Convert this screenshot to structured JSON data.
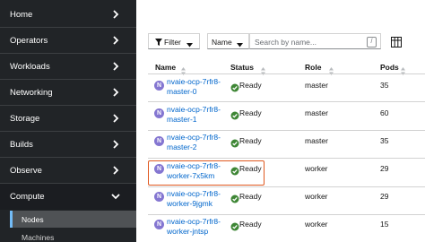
{
  "sidebar": {
    "items": [
      {
        "label": "Home"
      },
      {
        "label": "Operators"
      },
      {
        "label": "Workloads"
      },
      {
        "label": "Networking"
      },
      {
        "label": "Storage"
      },
      {
        "label": "Builds"
      },
      {
        "label": "Observe"
      },
      {
        "label": "Compute"
      }
    ],
    "compute_children": [
      {
        "label": "Nodes",
        "active": true
      },
      {
        "label": "Machines",
        "active": false
      }
    ]
  },
  "toolbar": {
    "filter_label": "Filter",
    "name_select_value": "Name",
    "search_placeholder": "Search by name...",
    "search_shortcut": "/"
  },
  "table": {
    "columns": [
      "Name",
      "Status",
      "Role",
      "Pods"
    ],
    "rows": [
      {
        "badge": "N",
        "name_line1": "nvaie-ocp-7rfr8-",
        "name_line2": "master-0",
        "status": "Ready",
        "role": "master",
        "pods": "35"
      },
      {
        "badge": "N",
        "name_line1": "nvaie-ocp-7rfr8-",
        "name_line2": "master-1",
        "status": "Ready",
        "role": "master",
        "pods": "60"
      },
      {
        "badge": "N",
        "name_line1": "nvaie-ocp-7rfr8-",
        "name_line2": "master-2",
        "status": "Ready",
        "role": "master",
        "pods": "35"
      },
      {
        "badge": "N",
        "name_line1": "nvaie-ocp-7rfr8-",
        "name_line2": "worker-7x5km",
        "status": "Ready",
        "role": "worker",
        "pods": "29"
      },
      {
        "badge": "N",
        "name_line1": "nvaie-ocp-7rfr8-",
        "name_line2": "worker-9jgmk",
        "status": "Ready",
        "role": "worker",
        "pods": "29"
      },
      {
        "badge": "N",
        "name_line1": "nvaie-ocp-7rfr8-",
        "name_line2": "worker-jntsp",
        "status": "Ready",
        "role": "worker",
        "pods": "15"
      }
    ]
  },
  "colors": {
    "sidebar_bg": "#212427",
    "link": "#0066cc",
    "node_badge": "#8476d1",
    "ready_icon": "#3e8635",
    "highlight": "#e0581f"
  },
  "icons": {
    "nav_chevron": "chevron-right-icon",
    "filter": "filter-icon",
    "dropdown": "caret-down-icon",
    "columns": "manage-columns-icon",
    "sort": "sort-icon",
    "status_ready": "check-circle-icon"
  }
}
